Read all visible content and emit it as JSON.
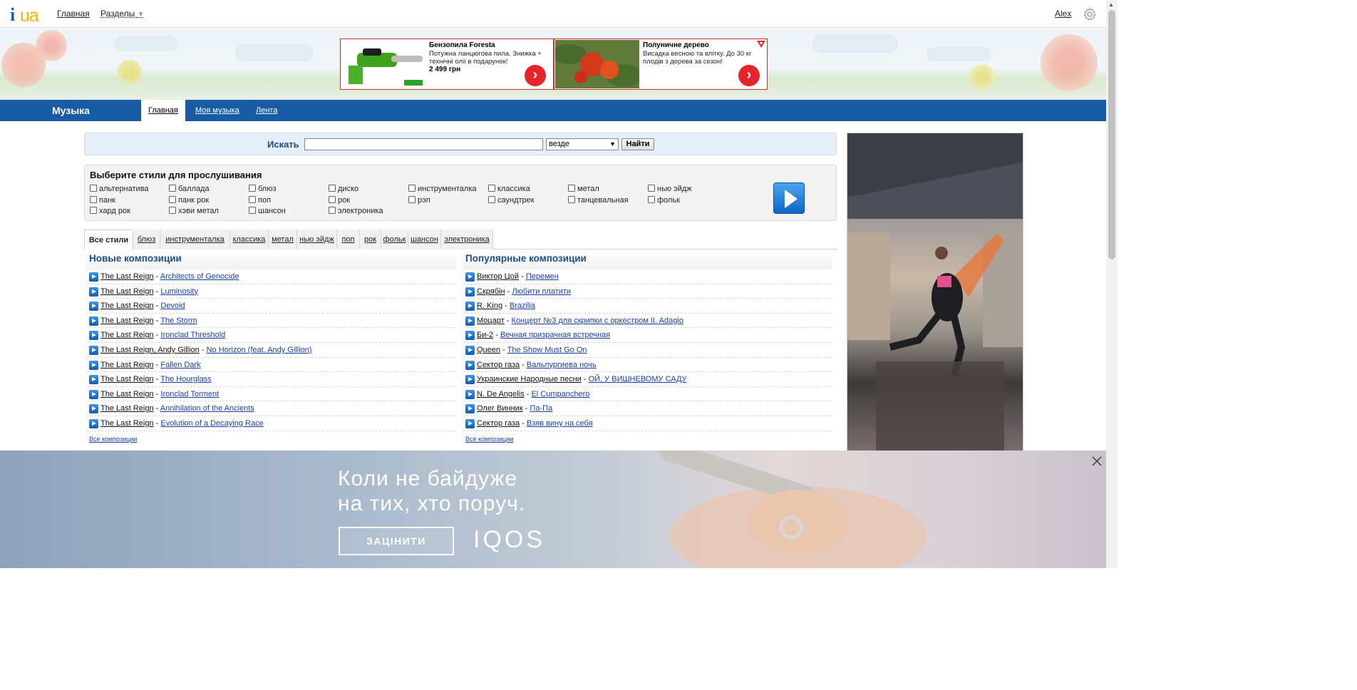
{
  "header": {
    "logo_i": "i",
    "logo_ua": "ua",
    "nav": {
      "home": "Главная",
      "sections": "Разделы"
    },
    "user": "Alex"
  },
  "banner_ads": [
    {
      "title": "Бензопила Foresta",
      "desc": "Потужна ланцюгова пила. Знижка + технічні олії в подарунок!",
      "price": "2 499 грн"
    },
    {
      "title": "Полуничне дерево",
      "desc": "Висадка весною та влітку. До 30 кг плодів з дерева за сезон!",
      "price": ""
    }
  ],
  "section": {
    "title": "Музыка",
    "tabs": [
      "Главная",
      "Моя музыка",
      "Лента"
    ],
    "active_tab": 0
  },
  "search": {
    "label": "Искать",
    "value": "",
    "scope": "везде",
    "button": "Найти"
  },
  "styles": {
    "title": "Выберите стили для прослушивания",
    "items": [
      [
        "альтернатива",
        "панк",
        "хард рок"
      ],
      [
        "баллада",
        "панк рок",
        "хэви метал"
      ],
      [
        "блюз",
        "поп",
        "шансон"
      ],
      [
        "диско",
        "рок",
        "электроника"
      ],
      [
        "инструменталка",
        "рэп",
        ""
      ],
      [
        "классика",
        "саундтрек",
        ""
      ],
      [
        "метал",
        "танцевальная",
        ""
      ],
      [
        "нью эйдж",
        "фольк",
        ""
      ]
    ]
  },
  "genre_tabs": [
    "Все стили",
    "блюз",
    "инструменталка",
    "классика",
    "метал",
    "нью эйдж",
    "поп",
    "рок",
    "фольк",
    "шансон",
    "электроника"
  ],
  "new_tracks": {
    "title": "Новые композиции",
    "more": "Все композиции",
    "items": [
      {
        "artist": "The Last Reign",
        "song": "Architects of Genocide"
      },
      {
        "artist": "The Last Reign",
        "song": "Luminosity"
      },
      {
        "artist": "The Last Reign",
        "song": "Devoid"
      },
      {
        "artist": "The Last Reign",
        "song": "The Storm"
      },
      {
        "artist": "The Last Reign",
        "song": "Ironclad Threshold"
      },
      {
        "artist": "The Last Reign, Andy Gillion",
        "song": "No Horizon (feat. Andy Gillion)"
      },
      {
        "artist": "The Last Reign",
        "song": "Fallen Dark"
      },
      {
        "artist": "The Last Reign",
        "song": "The Hourglass"
      },
      {
        "artist": "The Last Reign",
        "song": "Ironclad Torment"
      },
      {
        "artist": "The Last Reign",
        "song": "Annihilation of the Ancients"
      },
      {
        "artist": "The Last Reign",
        "song": "Evolution of a Decaying Race"
      }
    ]
  },
  "popular_tracks": {
    "title": "Популярные композиции",
    "more": "Все композиции",
    "items": [
      {
        "artist": "Виктор Цой",
        "song": "Перемен"
      },
      {
        "artist": "Скрябін",
        "song": "Любити платити"
      },
      {
        "artist": "R. King",
        "song": "Brazilia"
      },
      {
        "artist": "Моцарт",
        "song": "Концерт №3 для скрипки с оркестром II. Adagio"
      },
      {
        "artist": "Би-2",
        "song": "Вечная призрачная встречная"
      },
      {
        "artist": "Queen",
        "song": "The Show Must Go On"
      },
      {
        "artist": "Сектор газа",
        "song": "Вальпургиева ночь"
      },
      {
        "artist": "Украинские Народные песни",
        "song": "ОЙ, У ВИШНЕВОМУ САДУ"
      },
      {
        "artist": "N. De Angelis",
        "song": "El Cumpanchero"
      },
      {
        "artist": "Олег Винник",
        "song": "Па-Па"
      },
      {
        "artist": "Сектор газа",
        "song": "Взяв вину на себя"
      }
    ]
  },
  "bottom_ad": {
    "line1": "Коли не байдуже",
    "line2": "на тих, хто поруч.",
    "cta": "ЗАЦІНИТИ",
    "brand": "IQOS"
  },
  "colors": {
    "brand_blue": "#1a5ba6",
    "link": "#1a3fa8",
    "ad_red": "#e5252a"
  }
}
